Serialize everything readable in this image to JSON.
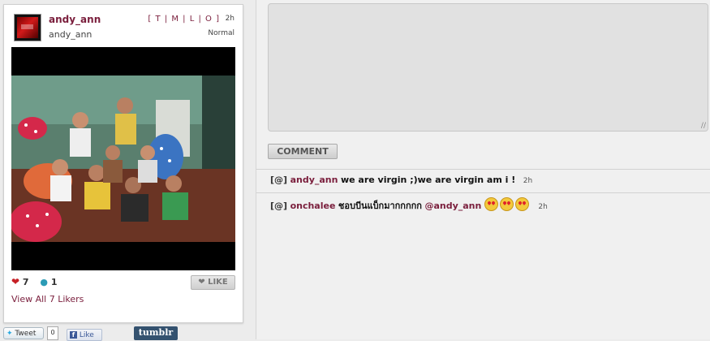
{
  "post": {
    "username": "andy_ann",
    "full_name": "andy_ann",
    "link_labels": [
      "[ ",
      "T",
      " | ",
      "M",
      " | ",
      "L",
      " | ",
      "O",
      " ]"
    ],
    "time": "2h",
    "filter": "Normal",
    "likes_count": "7",
    "comments_count": "1",
    "like_button": "LIKE",
    "view_likers": "View All 7 Likers"
  },
  "share": {
    "tweet_label": "Tweet",
    "tweet_count": "0",
    "facebook_label": "Like",
    "tumblr_label": "tumblr"
  },
  "comment_form": {
    "button_label": "COMMENT"
  },
  "comments": [
    {
      "at": "[@]",
      "author": "andy_ann",
      "text": "we are virgin ;)we are virgin am i !",
      "time": "2h"
    },
    {
      "at": "[@]",
      "author": "onchalee",
      "text": "ชอบบีนแบ็กมากกกกก",
      "mention": "@andy_ann",
      "emoji_count": 3,
      "emoji": "heart-eyes-emoji",
      "time": "2h"
    }
  ],
  "colors": {
    "accent": "#7a1e3c",
    "like_heart": "#c62026",
    "comment_bubble": "#2b9bb5"
  }
}
